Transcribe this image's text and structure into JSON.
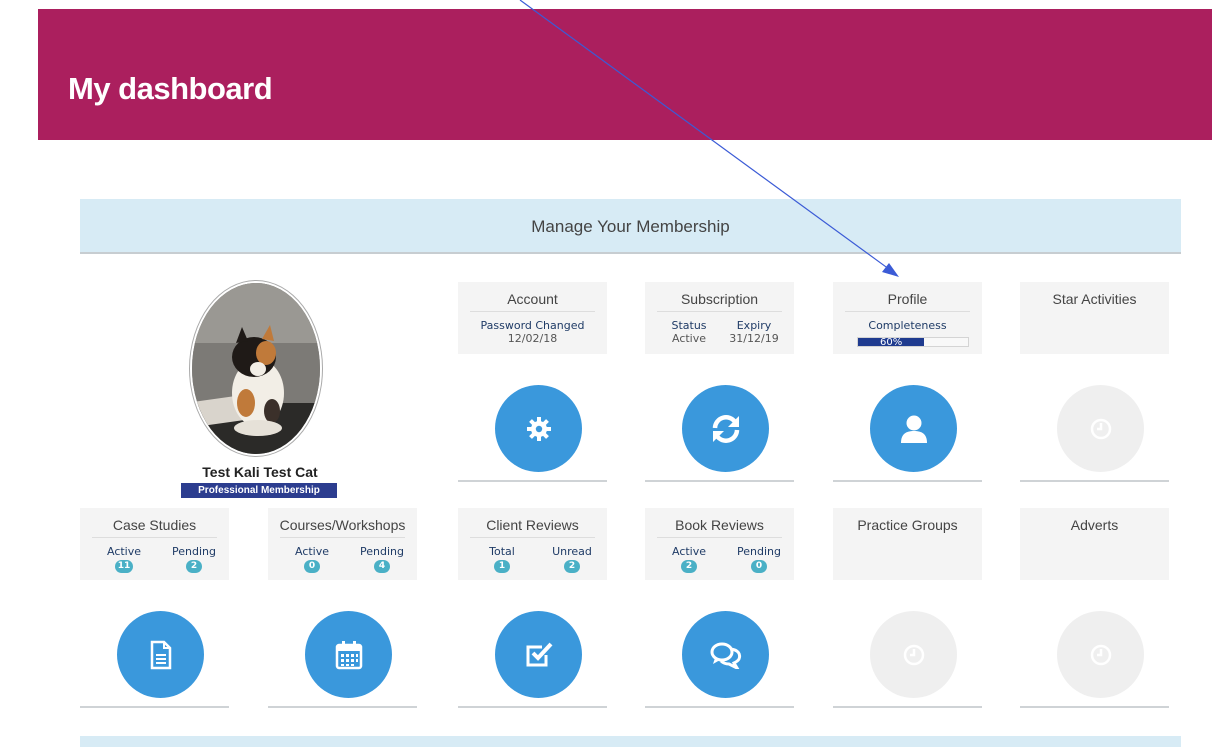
{
  "header": {
    "title": "My dashboard"
  },
  "section": {
    "title": "Manage Your Membership"
  },
  "profile": {
    "name": "Test Kali Test Cat",
    "membership": "Professional Membership"
  },
  "tiles": {
    "account": {
      "title": "Account",
      "sub_label": "Password Changed",
      "sub_value": "12/02/18",
      "icon": "gear-icon"
    },
    "subscription": {
      "title": "Subscription",
      "col1_label": "Status",
      "col1_value": "Active",
      "col2_label": "Expiry",
      "col2_value": "31/12/19",
      "icon": "refresh-icon"
    },
    "profile": {
      "title": "Profile",
      "sub_label": "Completeness",
      "progress_text": "60%",
      "progress_value": 0.6,
      "icon": "user-icon"
    },
    "star_activities": {
      "title": "Star Activities",
      "icon": "clock-icon"
    },
    "case_studies": {
      "title": "Case Studies",
      "col1_label": "Active",
      "col1_badge": "11",
      "col2_label": "Pending",
      "col2_badge": "2",
      "icon": "document-icon"
    },
    "courses": {
      "title": "Courses/Workshops",
      "col1_label": "Active",
      "col1_badge": "0",
      "col2_label": "Pending",
      "col2_badge": "4",
      "icon": "calendar-icon"
    },
    "client_reviews": {
      "title": "Client Reviews",
      "col1_label": "Total",
      "col1_badge": "1",
      "col2_label": "Unread",
      "col2_badge": "2",
      "icon": "check-square-icon"
    },
    "book_reviews": {
      "title": "Book Reviews",
      "col1_label": "Active",
      "col1_badge": "2",
      "col2_label": "Pending",
      "col2_badge": "0",
      "icon": "comments-icon"
    },
    "practice_groups": {
      "title": "Practice Groups",
      "icon": "clock-icon"
    },
    "adverts": {
      "title": "Adverts",
      "icon": "clock-icon"
    }
  },
  "colors": {
    "header_bg": "#ab1f5e",
    "accent": "#3a98dc",
    "section_bg": "#d7ebf5",
    "badge": "#4ab0c6"
  }
}
